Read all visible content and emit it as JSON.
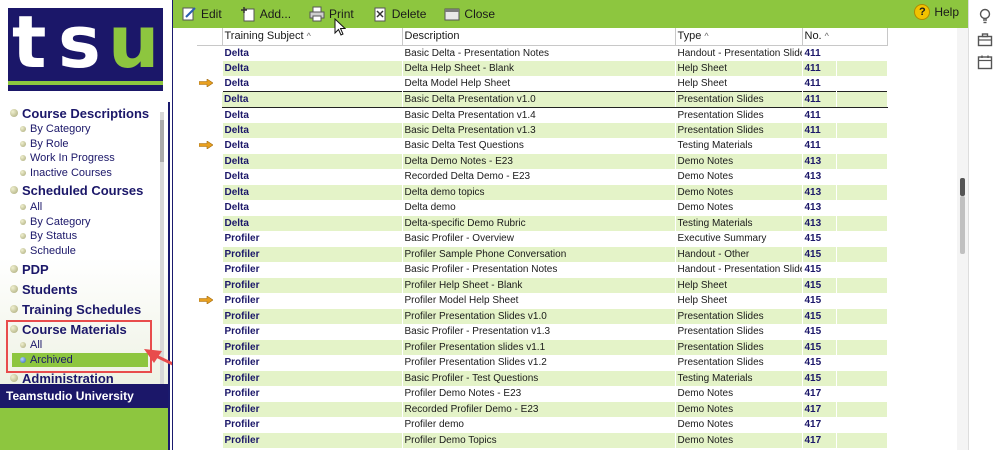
{
  "brand": {
    "logo_t": "t",
    "logo_s": "s",
    "logo_u": "u",
    "footer": "Teamstudio University"
  },
  "nav": {
    "course_descriptions": "Course Descriptions",
    "cd_by_category": "By Category",
    "cd_by_role": "By Role",
    "cd_work_in_progress": "Work In Progress",
    "cd_inactive": "Inactive Courses",
    "scheduled_courses": "Scheduled Courses",
    "sc_all": "All",
    "sc_by_category": "By Category",
    "sc_by_status": "By Status",
    "sc_schedule": "Schedule",
    "pdp": "PDP",
    "students": "Students",
    "training_schedules": "Training Schedules",
    "course_materials": "Course Materials",
    "cm_all": "All",
    "cm_archived": "Archived",
    "administration": "Administration"
  },
  "toolbar": {
    "edit": "Edit",
    "add": "Add...",
    "print": "Print",
    "delete": "Delete",
    "close": "Close",
    "help": "Help"
  },
  "table": {
    "headers": {
      "subject": "Training Subject",
      "description": "Description",
      "type": "Type",
      "number": "No."
    },
    "rows": [
      {
        "subject": "Delta",
        "description": "Basic Delta - Presentation Notes",
        "type": "Handout - Presentation Slides",
        "number": "411",
        "flag": false
      },
      {
        "subject": "Delta",
        "description": "Delta Help Sheet - Blank",
        "type": "Help Sheet",
        "number": "411",
        "flag": false
      },
      {
        "subject": "Delta",
        "description": "Delta Model Help Sheet",
        "type": "Help Sheet",
        "number": "411",
        "flag": true
      },
      {
        "subject": "Delta",
        "description": "Basic Delta Presentation v1.0",
        "type": "Presentation Slides",
        "number": "411",
        "flag": false
      },
      {
        "subject": "Delta",
        "description": "Basic Delta Presentation v1.4",
        "type": "Presentation Slides",
        "number": "411",
        "flag": false
      },
      {
        "subject": "Delta",
        "description": "Basic Delta Presentation v1.3",
        "type": "Presentation Slides",
        "number": "411",
        "flag": false
      },
      {
        "subject": "Delta",
        "description": "Basic Delta Test Questions",
        "type": "Testing Materials",
        "number": "411",
        "flag": true
      },
      {
        "subject": "Delta",
        "description": "Delta Demo Notes - E23",
        "type": "Demo Notes",
        "number": "413",
        "flag": false
      },
      {
        "subject": "Delta",
        "description": "Recorded Delta Demo - E23",
        "type": "Demo Notes",
        "number": "413",
        "flag": false
      },
      {
        "subject": "Delta",
        "description": "Delta demo topics",
        "type": "Demo Notes",
        "number": "413",
        "flag": false
      },
      {
        "subject": "Delta",
        "description": "Delta demo",
        "type": "Demo Notes",
        "number": "413",
        "flag": false
      },
      {
        "subject": "Delta",
        "description": "Delta-specific Demo Rubric",
        "type": "Testing Materials",
        "number": "413",
        "flag": false
      },
      {
        "subject": "Profiler",
        "description": "Basic Profiler - Overview",
        "type": "Executive Summary",
        "number": "415",
        "flag": false
      },
      {
        "subject": "Profiler",
        "description": "Profiler Sample Phone Conversation",
        "type": "Handout - Other",
        "number": "415",
        "flag": false
      },
      {
        "subject": "Profiler",
        "description": "Basic Profiler - Presentation Notes",
        "type": "Handout - Presentation Slides",
        "number": "415",
        "flag": false
      },
      {
        "subject": "Profiler",
        "description": "Profiler Help Sheet - Blank",
        "type": "Help Sheet",
        "number": "415",
        "flag": false
      },
      {
        "subject": "Profiler",
        "description": "Profiler Model Help Sheet",
        "type": "Help Sheet",
        "number": "415",
        "flag": true
      },
      {
        "subject": "Profiler",
        "description": "Profiler Presentation Slides v1.0",
        "type": "Presentation Slides",
        "number": "415",
        "flag": false
      },
      {
        "subject": "Profiler",
        "description": "Basic Profiler - Presentation v1.3",
        "type": "Presentation Slides",
        "number": "415",
        "flag": false
      },
      {
        "subject": "Profiler",
        "description": "Profiler Presentation slides v1.1",
        "type": "Presentation Slides",
        "number": "415",
        "flag": false
      },
      {
        "subject": "Profiler",
        "description": "Profiler Presentation Slides v1.2",
        "type": "Presentation Slides",
        "number": "415",
        "flag": false
      },
      {
        "subject": "Profiler",
        "description": "Basic Profiler - Test Questions",
        "type": "Testing Materials",
        "number": "415",
        "flag": false
      },
      {
        "subject": "Profiler",
        "description": "Profiler Demo Notes - E23",
        "type": "Demo Notes",
        "number": "417",
        "flag": false
      },
      {
        "subject": "Profiler",
        "description": "Recorded Profiler Demo - E23",
        "type": "Demo Notes",
        "number": "417",
        "flag": false
      },
      {
        "subject": "Profiler",
        "description": "Profiler demo",
        "type": "Demo Notes",
        "number": "417",
        "flag": false
      },
      {
        "subject": "Profiler",
        "description": "Profiler Demo Topics",
        "type": "Demo Notes",
        "number": "417",
        "flag": false
      }
    ]
  },
  "colors": {
    "brand_navy": "#1b1769",
    "brand_green": "#8dc63f",
    "row_alt": "#e4f3c8",
    "highlight_red": "#e84c4c"
  },
  "icons": {
    "edit": "pencil-icon",
    "add": "add-document-icon",
    "print": "printer-icon",
    "delete": "delete-icon",
    "close": "close-icon",
    "help": "help-icon",
    "rail_1": "lightbulb-icon",
    "rail_2": "briefcase-icon",
    "rail_3": "calendar-icon"
  }
}
